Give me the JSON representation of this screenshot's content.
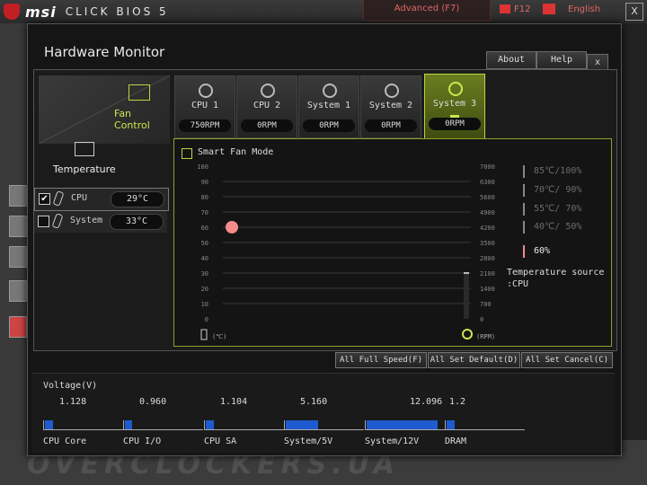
{
  "header": {
    "brand": "msi",
    "product": "CLICK BIOS 5",
    "mode": "Advanced (F7)",
    "screenshot_key": "F12",
    "language": "English"
  },
  "window": {
    "title": "Hardware Monitor",
    "about": "About",
    "help": "Help",
    "close": "x"
  },
  "left": {
    "fan_control": "Fan Control",
    "temperature": "Temperature",
    "sensors": [
      {
        "name": "CPU",
        "value": "29°C",
        "checked": "✔"
      },
      {
        "name": "System",
        "value": "33°C",
        "checked": ""
      }
    ]
  },
  "fans": [
    {
      "name": "CPU 1",
      "rpm": "750RPM"
    },
    {
      "name": "CPU 2",
      "rpm": "0RPM"
    },
    {
      "name": "System 1",
      "rpm": "0RPM"
    },
    {
      "name": "System 2",
      "rpm": "0RPM"
    },
    {
      "name": "System 3",
      "rpm": "0RPM"
    }
  ],
  "smart_fan": {
    "label": "Smart Fan Mode",
    "temp_unit": "(℃)",
    "rpm_unit": "(RPM)",
    "y_left": [
      "100",
      "90",
      "80",
      "70",
      "60",
      "50",
      "40",
      "30",
      "20",
      "10",
      "0"
    ],
    "y_right": [
      "7000",
      "6300",
      "5600",
      "4900",
      "4200",
      "3500",
      "2800",
      "2100",
      "1400",
      "700",
      "0"
    ],
    "point_percent": 60,
    "legend": [
      {
        "text": "85℃/100%",
        "color": "#6c6c6c"
      },
      {
        "text": "70℃/ 90%",
        "color": "#6c6c6c"
      },
      {
        "text": "55℃/ 70%",
        "color": "#6c6c6c"
      },
      {
        "text": "40℃/ 50%",
        "color": "#6c6c6c"
      },
      {
        "text": "60%",
        "color": "#e8e8e8"
      }
    ],
    "point_color": "#f28b8b",
    "temp_source_label": "Temperature source",
    "temp_source_value": ":CPU"
  },
  "actions": {
    "full_speed": "All Full Speed(F)",
    "set_default": "All Set Default(D)",
    "set_cancel": "All Set Cancel(C)"
  },
  "voltage": {
    "title": "Voltage(V)",
    "rails": [
      {
        "name": "CPU Core",
        "value": "1.128",
        "fill": 0.11
      },
      {
        "name": "CPU I/O",
        "value": "0.960",
        "fill": 0.09
      },
      {
        "name": "CPU SA",
        "value": "1.104",
        "fill": 0.11
      },
      {
        "name": "System/5V",
        "value": "5.160",
        "fill": 0.42
      },
      {
        "name": "System/12V",
        "value": "12.096",
        "fill": 0.92
      },
      {
        "name": "DRAM",
        "value": "1.2",
        "fill": 0.11
      }
    ]
  },
  "watermark": "OVERCLOCKERS.UA"
}
